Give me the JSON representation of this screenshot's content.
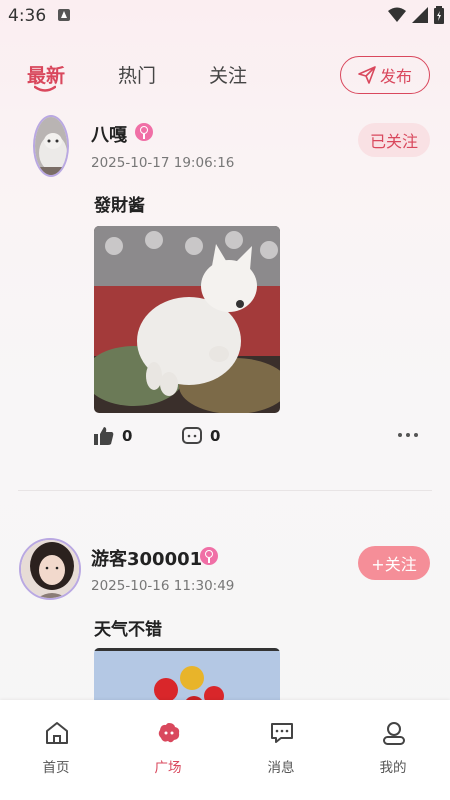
{
  "status_bar": {
    "time": "4:36"
  },
  "tabs": {
    "items": [
      {
        "label": "最新"
      },
      {
        "label": "热门"
      },
      {
        "label": "关注"
      }
    ],
    "publish_label": "发布"
  },
  "posts": [
    {
      "username": "八嘎",
      "time": "2025-10-17 19:06:16",
      "text": "發財酱",
      "follow_label": "已关注",
      "likes": "0",
      "comments": "0"
    },
    {
      "username": "游客300001",
      "time": "2025-10-16 11:30:49",
      "text": "天气不错",
      "follow_label": "+关注"
    }
  ],
  "nav": {
    "items": [
      {
        "label": "首页",
        "icon": "home-icon"
      },
      {
        "label": "广场",
        "icon": "plaza-icon"
      },
      {
        "label": "消息",
        "icon": "message-icon"
      },
      {
        "label": "我的",
        "icon": "profile-icon"
      }
    ]
  },
  "colors": {
    "accent": "#d9485d",
    "follow_button": "#f58e98",
    "followed_bg": "#f9e1e4"
  }
}
